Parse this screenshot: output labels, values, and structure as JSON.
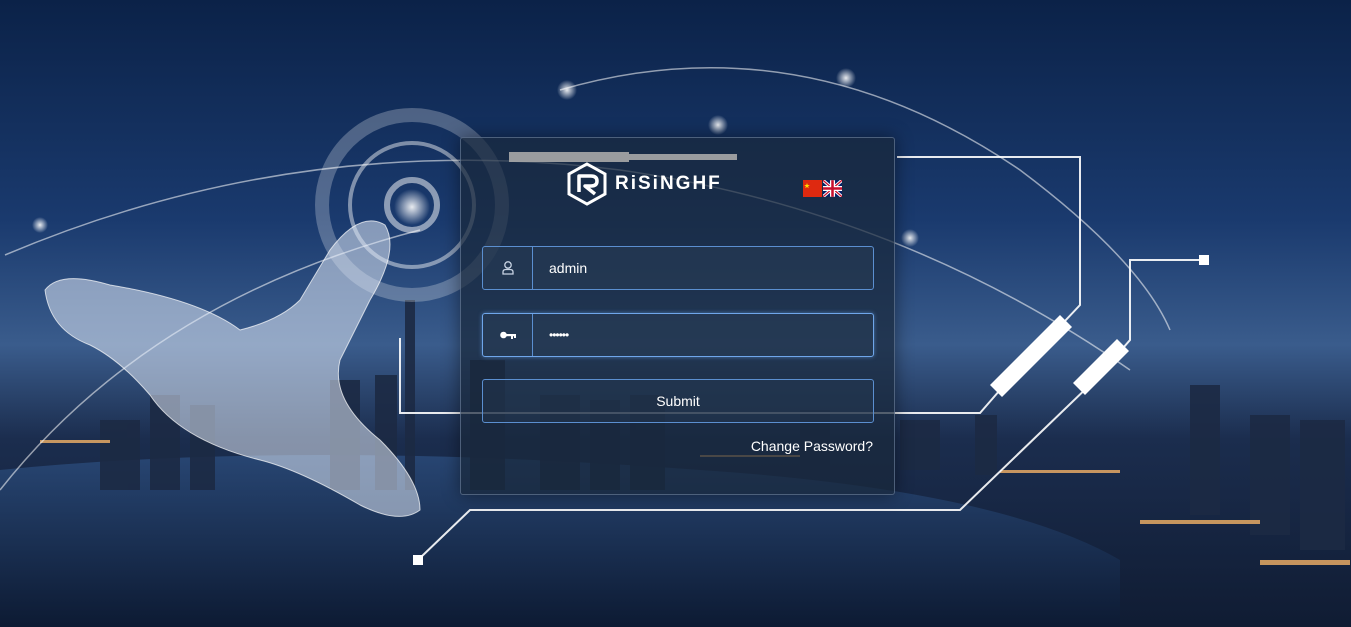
{
  "brand": {
    "name": "RiSiNGHF",
    "logo_icon": "risinghf-hexagon-logo"
  },
  "language": {
    "options": [
      "chinese-flag-icon",
      "uk-flag-icon"
    ]
  },
  "form": {
    "username": {
      "value": "admin",
      "icon": "user-icon"
    },
    "password": {
      "value": "••••••",
      "icon": "key-icon"
    },
    "submit_label": "Submit",
    "change_password_label": "Change Password?"
  },
  "colors": {
    "panel_border": "#5b8fd0",
    "panel_bg": "rgba(25,40,60,0.72)",
    "text": "#ffffff"
  }
}
